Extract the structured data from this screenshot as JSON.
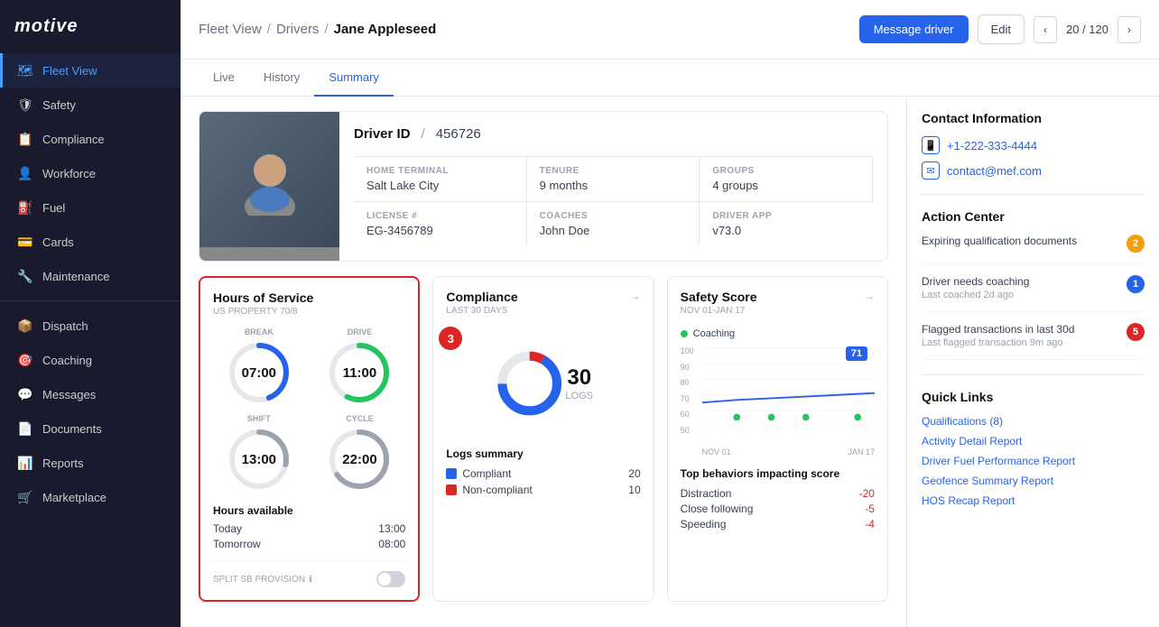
{
  "sidebar": {
    "logo": "motive",
    "items": [
      {
        "id": "fleet-view",
        "label": "Fleet View",
        "icon": "🗺",
        "active": true
      },
      {
        "id": "safety",
        "label": "Safety",
        "icon": "🛡",
        "active": false
      },
      {
        "id": "compliance",
        "label": "Compliance",
        "icon": "📋",
        "active": false
      },
      {
        "id": "workforce",
        "label": "Workforce",
        "icon": "👤",
        "active": false
      },
      {
        "id": "fuel",
        "label": "Fuel",
        "icon": "⛽",
        "active": false
      },
      {
        "id": "cards",
        "label": "Cards",
        "icon": "💳",
        "active": false
      },
      {
        "id": "maintenance",
        "label": "Maintenance",
        "icon": "🔧",
        "active": false
      },
      {
        "id": "dispatch",
        "label": "Dispatch",
        "icon": "📦",
        "active": false
      },
      {
        "id": "coaching",
        "label": "Coaching",
        "icon": "🎯",
        "active": false
      },
      {
        "id": "messages",
        "label": "Messages",
        "icon": "💬",
        "active": false
      },
      {
        "id": "documents",
        "label": "Documents",
        "icon": "📄",
        "active": false
      },
      {
        "id": "reports",
        "label": "Reports",
        "icon": "📊",
        "active": false
      },
      {
        "id": "marketplace",
        "label": "Marketplace",
        "icon": "🛒",
        "active": false
      }
    ]
  },
  "header": {
    "breadcrumb": {
      "fleet_view": "Fleet View",
      "drivers": "Drivers",
      "driver_name": "Jane Appleseed"
    },
    "message_driver_btn": "Message driver",
    "edit_btn": "Edit",
    "nav_current": "20",
    "nav_total": "120"
  },
  "tabs": [
    {
      "id": "live",
      "label": "Live",
      "active": false
    },
    {
      "id": "history",
      "label": "History",
      "active": false
    },
    {
      "id": "summary",
      "label": "Summary",
      "active": true
    }
  ],
  "driver": {
    "id_label": "Driver ID",
    "id_value": "456726",
    "home_terminal_label": "HOME TERMINAL",
    "home_terminal": "Salt Lake City",
    "tenure_label": "TENURE",
    "tenure": "9 months",
    "groups_label": "GROUPS",
    "groups": "4 groups",
    "license_label": "LICENSE #",
    "license": "EG-3456789",
    "coaches_label": "COACHES",
    "coaches": "John Doe",
    "driver_app_label": "DRIVER APP",
    "driver_app": "v73.0"
  },
  "hos_card": {
    "title": "Hours of Service",
    "subtitle": "US PROPERTY 70/8",
    "break_label": "BREAK",
    "break_time": "07:00",
    "drive_label": "DRIVE",
    "drive_time": "11:00",
    "shift_label": "SHIFT",
    "shift_time": "13:00",
    "cycle_label": "CYCLE",
    "cycle_time": "22:00",
    "hours_available_title": "Hours available",
    "today_label": "Today",
    "today_value": "13:00",
    "tomorrow_label": "Tomorrow",
    "tomorrow_value": "08:00",
    "split_sb_label": "SPLIT SB PROVISION"
  },
  "compliance_card": {
    "title": "Compliance",
    "subtitle": "LAST 30 DAYS",
    "donut_number": "30",
    "donut_label": "LOGS",
    "badge": "3",
    "logs_summary_title": "Logs summary",
    "compliant_label": "Compliant",
    "compliant_value": "20",
    "noncompliant_label": "Non-compliant",
    "noncompliant_value": "10"
  },
  "safety_card": {
    "title": "Safety Score",
    "subtitle": "NOV 01-JAN 17",
    "coaching_label": "Coaching",
    "score_badge": "71",
    "y_labels": [
      "100",
      "90",
      "80",
      "70",
      "60",
      "50"
    ],
    "x_labels": [
      "NOV 01",
      "",
      "JAN 17"
    ],
    "behaviors_title": "Top behaviors impacting score",
    "behaviors": [
      {
        "name": "Distraction",
        "value": "-20"
      },
      {
        "name": "Close following",
        "value": "-5"
      },
      {
        "name": "Speeding",
        "value": "-4"
      }
    ]
  },
  "contact": {
    "title": "Contact Information",
    "phone": "+1-222-333-4444",
    "email": "contact@mef.com"
  },
  "action_center": {
    "title": "Action Center",
    "items": [
      {
        "main": "Expiring qualification documents",
        "sub": "",
        "badge": "2",
        "badge_type": "orange"
      },
      {
        "main": "Driver needs coaching",
        "sub": "Last coached 2d ago",
        "badge": "1",
        "badge_type": "blue"
      },
      {
        "main": "Flagged transactions in last 30d",
        "sub": "Last flagged transaction 9m ago",
        "badge": "5",
        "badge_type": "red"
      }
    ]
  },
  "quick_links": {
    "title": "Quick Links",
    "links": [
      {
        "label": "Qualifications (8)"
      },
      {
        "label": "Activity Detail Report"
      },
      {
        "label": "Driver Fuel Performance Report"
      },
      {
        "label": "Geofence Summary Report"
      },
      {
        "label": "HOS Recap Report"
      }
    ]
  }
}
